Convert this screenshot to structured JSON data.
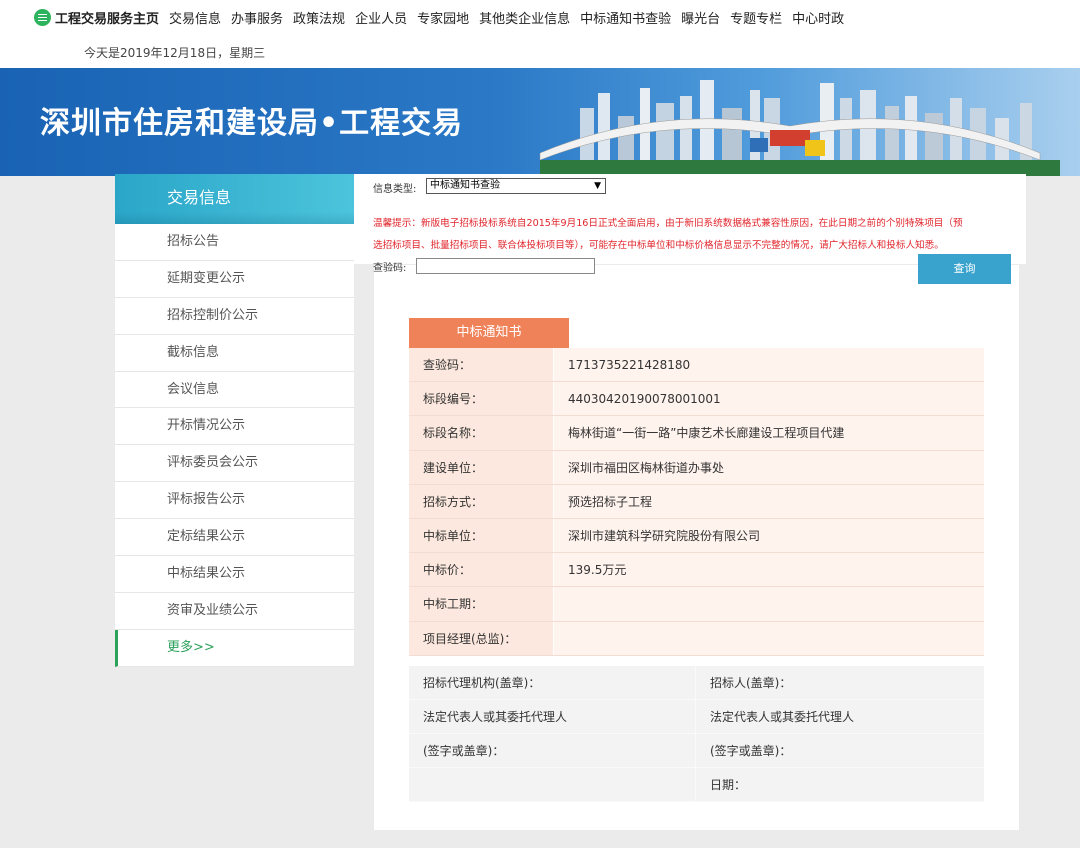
{
  "topnav": {
    "home": "工程交易服务主页",
    "items": [
      "交易信息",
      "办事服务",
      "政策法规",
      "企业人员",
      "专家园地",
      "其他类企业信息",
      "中标通知书查验",
      "曝光台",
      "专题专栏",
      "中心时政"
    ]
  },
  "date": "今天是2019年12月18日，星期三",
  "banner": {
    "title": "深圳市住房和建设局•工程交易"
  },
  "sidebar": {
    "title": "交易信息",
    "items": [
      "招标公告",
      "延期变更公示",
      "招标控制价公示",
      "截标信息",
      "会议信息",
      "开标情况公示",
      "评标委员会公示",
      "评标报告公示",
      "定标结果公示",
      "中标结果公示",
      "资审及业绩公示"
    ],
    "more": "更多>>"
  },
  "filter": {
    "type_label": "信息类型:",
    "type_value": "中标通知书查验",
    "notice_line1": "温馨提示：新版电子招标投标系统自2015年9月16日正式全面启用，由于新旧系统数据格式兼容性原因，在此日期之前的个别特殊项目（预",
    "notice_line2": "选招标项目、批量招标项目、联合体投标项目等），可能存在中标单位和中标价格信息显示不完整的情况，请广大招标人和投标人知悉。",
    "code_label": "查验码:",
    "code_value": "",
    "query_label": "查询"
  },
  "notice_card": {
    "title": "中标通知书",
    "rows": [
      {
        "k": "查验码：",
        "v": "1713735221428180"
      },
      {
        "k": "标段编号：",
        "v": "44030420190078001001"
      },
      {
        "k": "标段名称：",
        "v": "梅林街道“一街一路”中康艺术长廊建设工程项目代建"
      },
      {
        "k": "建设单位：",
        "v": "深圳市福田区梅林街道办事处"
      },
      {
        "k": "招标方式：",
        "v": "预选招标子工程"
      },
      {
        "k": "中标单位：",
        "v": "深圳市建筑科学研究院股份有限公司"
      },
      {
        "k": "中标价：",
        "v": "139.5万元"
      },
      {
        "k": "中标工期：",
        "v": ""
      },
      {
        "k": "项目经理(总监)：",
        "v": ""
      }
    ],
    "sign": {
      "left": [
        "招标代理机构(盖章)：",
        "法定代表人或其委托代理人",
        "(签字或盖章)：",
        ""
      ],
      "right": [
        "招标人(盖章)：",
        "法定代表人或其委托代理人",
        "(签字或盖章)：",
        "日期："
      ]
    }
  },
  "colors": {
    "accent_teal": "#3aa3cd",
    "tab_orange": "#f0825a",
    "notice_red": "#e0252c",
    "more_green": "#2ba15a"
  }
}
